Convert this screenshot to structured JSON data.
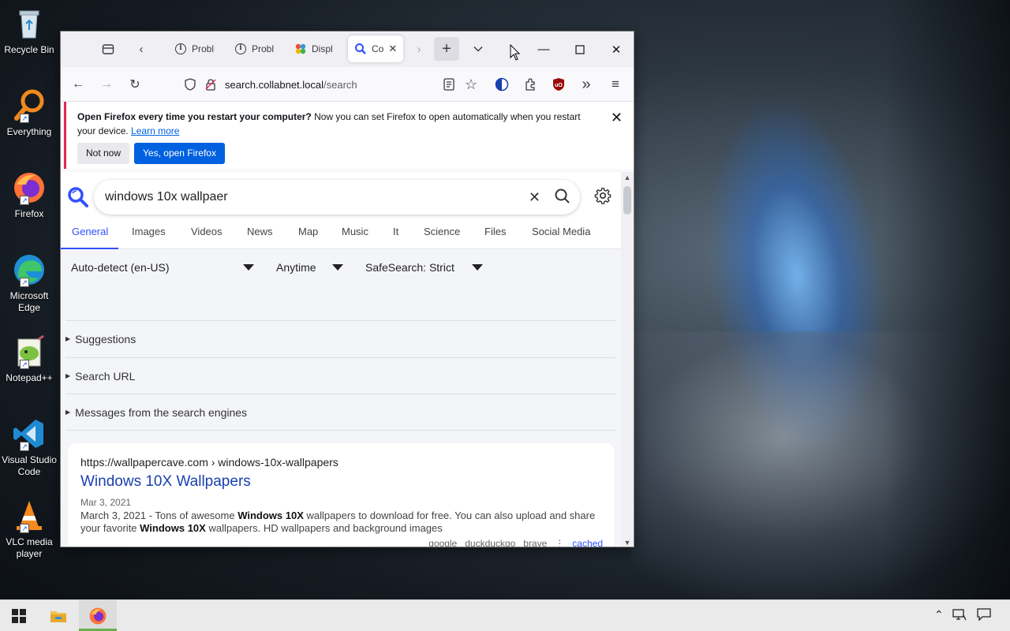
{
  "desktop": {
    "icons": [
      {
        "label": "Recycle Bin"
      },
      {
        "label": "Everything"
      },
      {
        "label": "Firefox"
      },
      {
        "label": "Microsoft Edge"
      },
      {
        "label": "Notepad++"
      },
      {
        "label": "Visual Studio Code"
      },
      {
        "label": "VLC media player"
      }
    ]
  },
  "browser": {
    "tabs": [
      {
        "label": "Probl",
        "icon": "info-icon"
      },
      {
        "label": "Probl",
        "icon": "info-icon"
      },
      {
        "label": "Displ",
        "icon": "colorful-flower-icon"
      },
      {
        "label": "Co",
        "icon": "search-icon",
        "active": true
      }
    ],
    "url_domain": "search.collabnet.local",
    "url_path": "/search",
    "notice": {
      "bold": "Open Firefox every time you restart your computer?",
      "text": " Now you can set Firefox to open automatically when you restart your device.",
      "link": "Learn more",
      "not_now": "Not now",
      "yes": "Yes, open Firefox"
    }
  },
  "search": {
    "query": "windows 10x wallpaer",
    "categories": [
      "General",
      "Images",
      "Videos",
      "News",
      "Map",
      "Music",
      "It",
      "Science",
      "Files",
      "Social Media"
    ],
    "active_category": "General",
    "filters": {
      "language": "Auto-detect (en-US)",
      "time": "Anytime",
      "safesearch": "SafeSearch: Strict"
    },
    "sections": [
      "Suggestions",
      "Search URL",
      "Messages from the search engines"
    ],
    "result": {
      "url": "https://wallpapercave.com",
      "path": "› windows-10x-wallpapers",
      "title": "Windows 10X Wallpapers",
      "date": "Mar 3, 2021",
      "desc_1": "March 3, 2021 - Tons of awesome ",
      "desc_b1": "Windows 10X",
      "desc_2": " wallpapers to download for free. You can also upload and share your favorite ",
      "desc_b2": "Windows 10X",
      "desc_3": " wallpapers. HD wallpapers and background images",
      "engines": [
        "google",
        "duckduckgo",
        "brave"
      ],
      "cached": "cached"
    }
  },
  "colors": {
    "accent": "#3050ff",
    "firefox_blue": "#0061e0"
  }
}
